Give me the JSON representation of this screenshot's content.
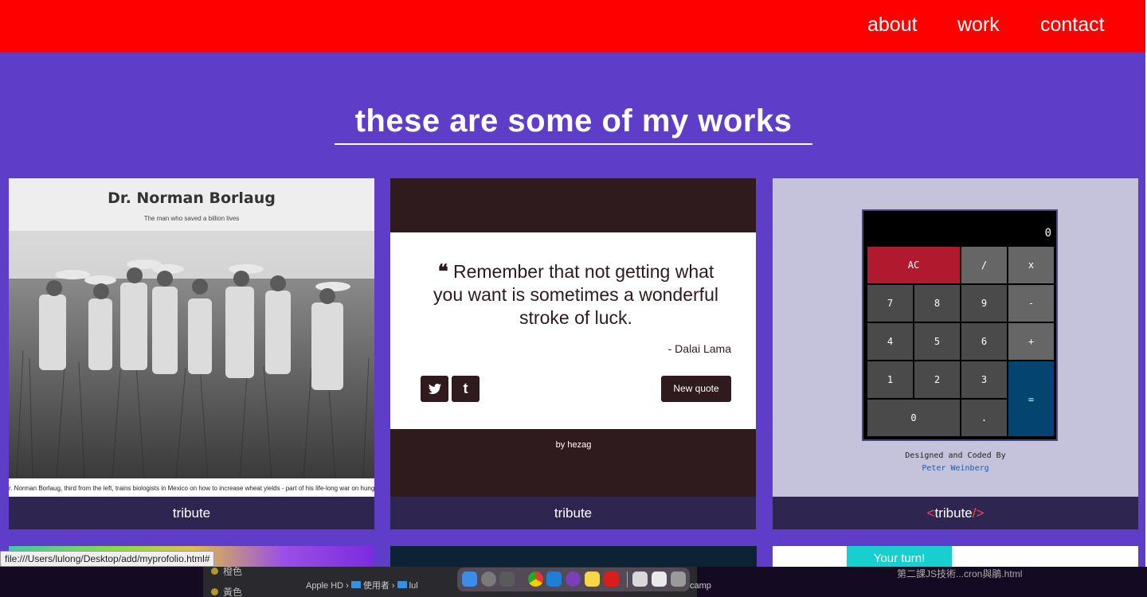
{
  "nav": {
    "about": "about",
    "work": "work",
    "contact": "contact"
  },
  "heading": "these are some of my works",
  "cards": [
    {
      "caption": "tribute",
      "title": "Dr. Norman Borlaug",
      "subtitle": "The man who saved a billion lives",
      "photo_caption": "r. Norman Borlaug, third from the left, trains biologists in Mexico on how to increase wheat yields - part of his life-long war on hunger"
    },
    {
      "caption": "tribute",
      "quote": "Remember that not getting what you want is sometimes a wonderful stroke of luck.",
      "author": "- Dalai Lama",
      "new_quote": "New quote",
      "tumblr": "t",
      "by_prefix": "by",
      "by_name": "hezag"
    },
    {
      "caption_open": "<",
      "caption": "tribute",
      "caption_close": "/>",
      "display": "0",
      "keys": {
        "ac": "AC",
        "div": "/",
        "mul": "x",
        "seven": "7",
        "eight": "8",
        "nine": "9",
        "minus": "-",
        "four": "4",
        "five": "5",
        "six": "6",
        "plus": "+",
        "one": "1",
        "two": "2",
        "three": "3",
        "equals": "=",
        "zero": "0",
        "dot": "."
      },
      "credit_line": "Designed and Coded By",
      "credit_author": "Peter Weinberg"
    }
  ],
  "row2": {
    "card3_button": "Your turn!"
  },
  "status_url": "file:///Users/lulong/Desktop/add/myprofolio.html#",
  "desktop": {
    "sidebar": [
      "橙色",
      "黃色"
    ],
    "path": [
      "Apple HD",
      "使用者",
      "lul"
    ],
    "camp": "camp",
    "right_window": "第二課JS技術...cron與鵑.html"
  },
  "colors": {
    "nav_bg": "#ff0000",
    "page_bg": "#5e3ec9",
    "caption_bg": "#2e2550"
  }
}
